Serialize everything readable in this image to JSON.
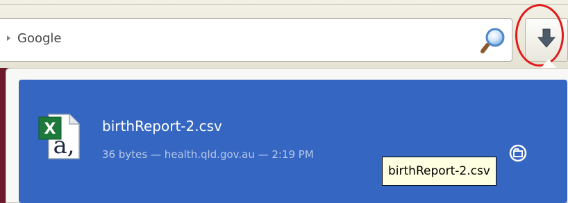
{
  "search": {
    "value": "Google",
    "engine_icon": "search-engine-dropdown-icon",
    "go_icon": "magnifier-icon"
  },
  "downloads_button": {
    "icon": "download-arrow-icon"
  },
  "download_item": {
    "filename": "birthReport-2.csv",
    "details": "36 bytes — health.qld.gov.au — 2:19 PM",
    "file_icon": "excel-csv-file-icon",
    "action_icon": "open-folder-icon"
  },
  "tooltip": {
    "text": "birthReport-2.csv"
  },
  "colors": {
    "accent": "#3566c1",
    "highlight_ring": "#e11b1b",
    "tooltip_bg": "#ffffe1",
    "page_bg": "#6d1b2c"
  }
}
